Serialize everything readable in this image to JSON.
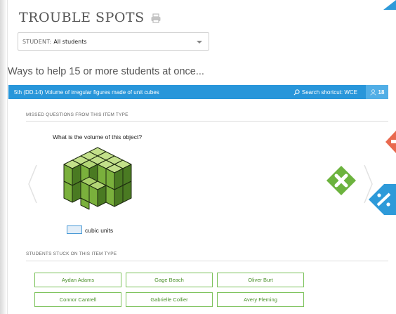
{
  "header": {
    "title": "TROUBLE SPOTS",
    "print_icon": "printer-icon"
  },
  "student_select": {
    "label": "STUDENT:",
    "value": "All students"
  },
  "ways_heading": "Ways to help 15 or more students at once...",
  "skill_bar": {
    "skill": "5th (DD.14)  Volume of irregular figures made of unit cubes",
    "shortcut": "Search shortcut: WCE",
    "count": "18",
    "color": "#2896da"
  },
  "missed": {
    "label": "MISSED QUESTIONS FROM THIS ITEM TYPE",
    "question": "What is the volume of this object?",
    "answer_unit": "cubic units"
  },
  "stuck": {
    "label": "STUDENTS STUCK ON THIS ITEM TYPE",
    "students": [
      "Aydan Adams",
      "Gage Beach",
      "Oliver Burt",
      "Connor Cantrell",
      "Gabrielle Collier",
      "Avery Fleming"
    ]
  },
  "colors": {
    "accent_green": "#7cc25b",
    "x_green": "#6cb33e",
    "deco_red": "#e9694f",
    "deco_blue": "#2e9ad9"
  }
}
